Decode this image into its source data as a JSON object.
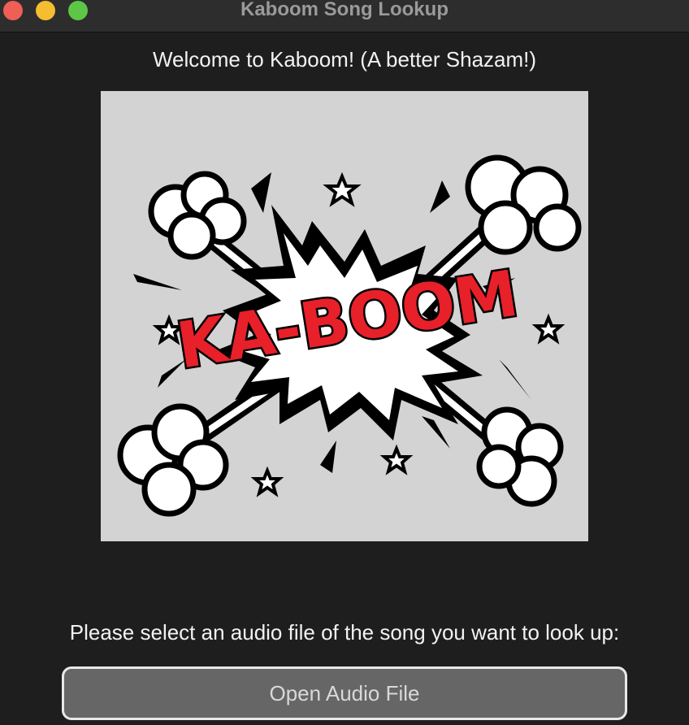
{
  "window": {
    "title": "Kaboom Song Lookup"
  },
  "main": {
    "welcome_text": "Welcome to Kaboom! (A better Shazam!)",
    "logo_text": "KA-BOOM",
    "prompt_text": "Please select an audio file of the song you want to look up:",
    "open_button_label": "Open Audio File"
  },
  "colors": {
    "background": "#1e1e1e",
    "logo_background": "#d3d3d3",
    "logo_text_red": "#e8202a",
    "button_background": "#666666"
  }
}
